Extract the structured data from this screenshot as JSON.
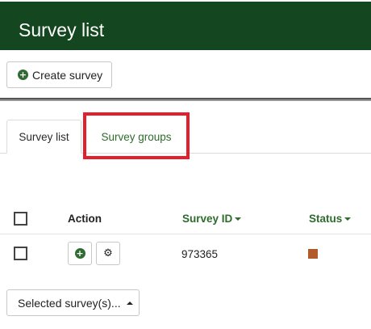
{
  "header": {
    "title": "Survey list"
  },
  "toolbar": {
    "create_label": "Create survey"
  },
  "tabs": [
    {
      "label": "Survey list",
      "active": true
    },
    {
      "label": "Survey groups",
      "active": false
    }
  ],
  "table": {
    "headers": {
      "action": "Action",
      "survey_id": "Survey ID",
      "status": "Status"
    },
    "rows": [
      {
        "survey_id": "973365",
        "status_color": "#b25a2c"
      }
    ]
  },
  "footer": {
    "selected_label": "Selected survey(s)..."
  },
  "colors": {
    "header_bg": "#14461f",
    "accent_green": "#2e6b2c",
    "highlight_red": "#e41e2b",
    "status_inactive": "#b25a2c"
  },
  "icons": {
    "create": "plus-circle-icon",
    "row_add": "plus-circle-icon",
    "row_settings": "gear-icon",
    "sort": "caret-down-icon",
    "dropdown": "caret-up-icon"
  }
}
